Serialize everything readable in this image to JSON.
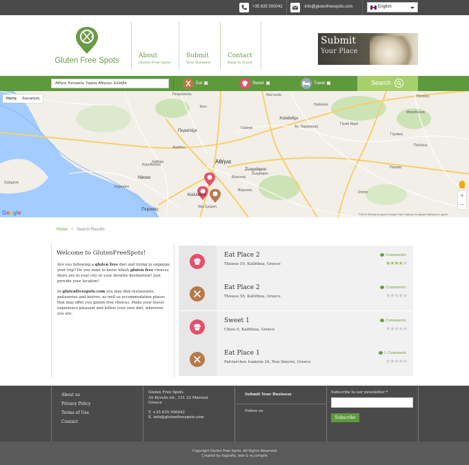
{
  "topbar": {
    "phone": "+35 635 500042",
    "email": ":info@glutenfreespots.com",
    "language": "English"
  },
  "header": {
    "brand": "Gluten Free Spots",
    "nav": [
      {
        "title": "About",
        "sub": "Gluten Free Spots"
      },
      {
        "title": "Submit",
        "sub": "Your Business"
      },
      {
        "title": "Contact",
        "sub": "Keep in Touch"
      }
    ],
    "banner": {
      "line1": "Submit",
      "line2": "Your Place"
    }
  },
  "search": {
    "location": "Αθήνα, Κεντρικός Τομέας Αθηνών, Ελλάδα",
    "filters": [
      {
        "label": "Eat",
        "color": "#b7794a"
      },
      {
        "label": "Sweet",
        "color": "#e5506a"
      },
      {
        "label": "Travel",
        "color": "#9aa8b6"
      }
    ],
    "button": "Search"
  },
  "map": {
    "types": [
      "Χάρτης",
      "Δορυφόρος"
    ],
    "places": [
      "Πετρούπολη",
      "Ίλιον",
      "Νέα Ιωνία",
      "Ηράκλειο",
      "Πεντέλη",
      "Περιστέρι",
      "Χαλάνδρι",
      "Αγ. Παρασκευή",
      "Γαλάτσι",
      "Αιγάλεω",
      "Αθήνα",
      "Ζωγράφου",
      "Χαϊδάρι",
      "Κορυδαλλός",
      "Νίκαια",
      "Καλλιθέα",
      "Νέα Σμύρνη",
      "Πειραιάς",
      "Σαλαμίνα",
      "Κερατσίνι",
      "Παλλήνη",
      "Γέρακας",
      "Παιανία",
      "Σπάτα",
      "Γλυκά Νερά",
      "Μαραθώνας",
      "Βύρωνας",
      "Γλυφάδα",
      "Άλιμος",
      "Παλαιό Φάληρο",
      "Ελευσίνα",
      "Ασπρόπυργος",
      "Κηφισιά",
      "Μεταμόρφωση",
      "Πειραιάς"
    ],
    "attribution": "©2016 Δεδομένα χάρτη Google   Όροι Χρήσης   Αναφορά σφάλματος χάρτη",
    "zoom_in": "+",
    "zoom_out": "−",
    "google": "Google"
  },
  "breadcrumb": {
    "home": "Home",
    "sep": "/",
    "current": "Search Results"
  },
  "welcome": {
    "title": "Welcome to GlutenFreeSpots!",
    "p1_pre": "Are you following a ",
    "p1_b1": "gluten free",
    "p1_mid": " diet and trying to organize your trip? Do you want to know which ",
    "p1_b2": "gluten free",
    "p1_post": " choices there are in your city or your favorite destination? Just provide your location!",
    "p2_pre": "In ",
    "p2_b": "glutenfreespots.com",
    "p2_post": " you may find restaurants, patisseries and bistros, as well as accommodation places that may offer you gluten free choices. Make your travel experience pleasant and follow your own diet, wherever you are."
  },
  "results": [
    {
      "title": "Eat Place 2",
      "address": "Thiseos 55, Kallithea, Greece",
      "comments": "Comments",
      "rating": 4,
      "category": "sweet",
      "color": "#e5506a"
    },
    {
      "title": "Eat Place 2",
      "address": "Thiseos 55, Kallithea, Greece",
      "comments": "Comments",
      "rating": 0,
      "category": "eat",
      "color": "#b7794a"
    },
    {
      "title": "Sweet 1",
      "address": "Chiou 9, Kallithea, Greece",
      "comments": "Comments",
      "rating": 0,
      "category": "sweet",
      "color": "#e5506a"
    },
    {
      "title": "Eat Place 1",
      "address": "Patriarchou Ioakeim 24, Nea Smyrni, Greece",
      "comments": "1 Comment",
      "rating": 0,
      "category": "eat",
      "color": "#b7794a"
    }
  ],
  "footer": {
    "links": [
      "About us",
      "Privacy Policy",
      "Terms of Use",
      "Contact"
    ],
    "company": "Gluten Free Spots",
    "address1": "3A Kyvelis str., 151 22 Marousi",
    "address2": "Greece",
    "phone": "T. +35 635 500042",
    "email": "E. info@glutenfreespots.com",
    "submit": "Submit Your Business",
    "follow": "Follow us",
    "newsletter": "Subscribe to our newsletter *",
    "subscribe": "Subscribe",
    "copyright": "Copyright Gluten Free Spots. All Rights Reserved",
    "created": "Created by dagrafix, bee & re.compile"
  }
}
